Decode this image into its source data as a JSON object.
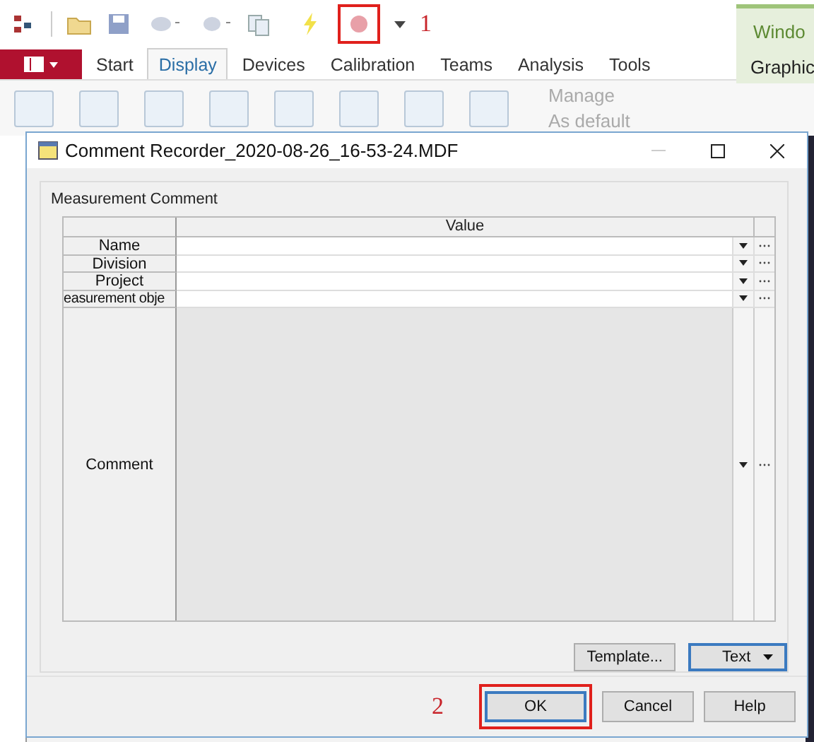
{
  "app": {
    "quick_access": {
      "record_annotation": "1"
    },
    "tabs": [
      {
        "label": "Start",
        "selected": false
      },
      {
        "label": "Display",
        "selected": true
      },
      {
        "label": "Devices",
        "selected": false
      },
      {
        "label": "Calibration",
        "selected": false
      },
      {
        "label": "Teams",
        "selected": false
      },
      {
        "label": "Analysis",
        "selected": false
      },
      {
        "label": "Tools",
        "selected": false
      }
    ],
    "context_group": {
      "title": "Windo",
      "tab": "Graphic"
    },
    "ribbon_commands": [
      {
        "label": "Manage"
      },
      {
        "label": "As default"
      }
    ]
  },
  "dialog": {
    "title": "Comment Recorder_2020-08-26_16-53-24.MDF",
    "group_title": "Measurement Comment",
    "column_header": "Value",
    "fields": [
      {
        "label": "Name"
      },
      {
        "label": "Division"
      },
      {
        "label": "Project"
      },
      {
        "label": "easurement obje"
      }
    ],
    "comment": {
      "label": "Comment"
    },
    "buttons": [
      {
        "label": "Template...",
        "kind": "plain",
        "focused": false
      },
      {
        "label": "Text",
        "kind": "dropdown",
        "focused": true
      }
    ],
    "ok_annotation": "2",
    "footer_buttons": [
      {
        "label": "OK",
        "focused": true,
        "highlighted": true
      },
      {
        "label": "Cancel",
        "focused": false,
        "highlighted": false
      },
      {
        "label": "Help",
        "focused": false,
        "highlighted": false
      }
    ]
  }
}
